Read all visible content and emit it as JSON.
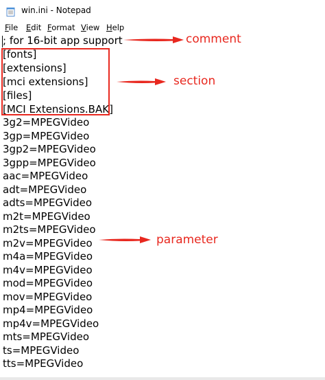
{
  "window": {
    "title": "win.ini - Notepad"
  },
  "menu": {
    "items": [
      {
        "acc": "F",
        "rest": "ile"
      },
      {
        "acc": "E",
        "rest": "dit"
      },
      {
        "acc": "F",
        "rest": "ormat"
      },
      {
        "acc": "V",
        "rest": "iew"
      },
      {
        "acc": "H",
        "rest": "elp"
      }
    ]
  },
  "editor": {
    "lines": [
      "; for 16-bit app support",
      "[fonts]",
      "[extensions]",
      "[mci extensions]",
      "[files]",
      "[MCI Extensions.BAK]",
      "3g2=MPEGVideo",
      "3gp=MPEGVideo",
      "3gp2=MPEGVideo",
      "3gpp=MPEGVideo",
      "aac=MPEGVideo",
      "adt=MPEGVideo",
      "adts=MPEGVideo",
      "m2t=MPEGVideo",
      "m2ts=MPEGVideo",
      "m2v=MPEGVideo",
      "m4a=MPEGVideo",
      "m4v=MPEGVideo",
      "mod=MPEGVideo",
      "mov=MPEGVideo",
      "mp4=MPEGVideo",
      "mp4v=MPEGVideo",
      "mts=MPEGVideo",
      "ts=MPEGVideo",
      "tts=MPEGVideo"
    ]
  },
  "annotations": {
    "comment": "comment",
    "section": "section",
    "parameter": "parameter",
    "color": "#e8281f"
  },
  "icons": {
    "app": "notepad-icon"
  }
}
